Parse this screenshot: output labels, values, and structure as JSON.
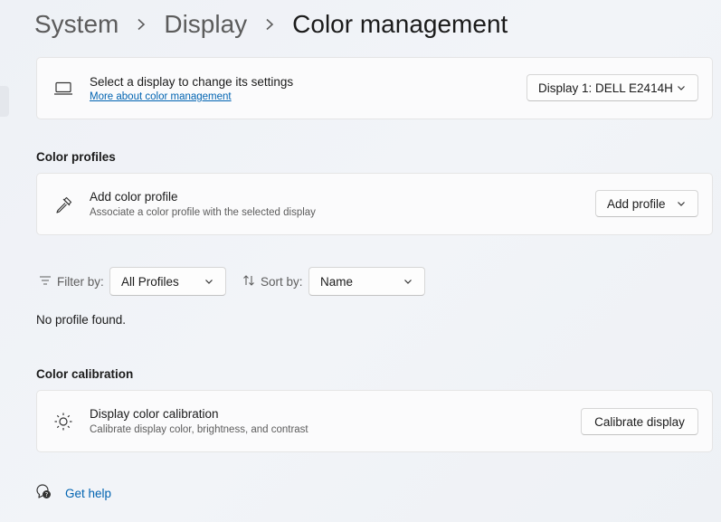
{
  "breadcrumb": {
    "items": [
      "System",
      "Display",
      "Color management"
    ]
  },
  "display_select": {
    "icon": "laptop-icon",
    "title": "Select a display to change its settings",
    "link": "More about color management",
    "dropdown_value": "Display 1: DELL E2414H"
  },
  "color_profiles": {
    "heading": "Color profiles",
    "add": {
      "icon": "eyedropper-icon",
      "title": "Add color profile",
      "subtitle": "Associate a color profile with the selected display",
      "button": "Add profile"
    },
    "filter": {
      "label": "Filter by:",
      "value": "All Profiles"
    },
    "sort": {
      "label": "Sort by:",
      "value": "Name"
    },
    "empty_message": "No profile found."
  },
  "calibration": {
    "heading": "Color calibration",
    "icon": "brightness-icon",
    "title": "Display color calibration",
    "subtitle": "Calibrate display color, brightness, and contrast",
    "button": "Calibrate display"
  },
  "help": {
    "icon": "help-chat-icon",
    "label": "Get help"
  },
  "colors": {
    "accent_link": "#0063b1",
    "card_background": "#fbfbfc"
  }
}
